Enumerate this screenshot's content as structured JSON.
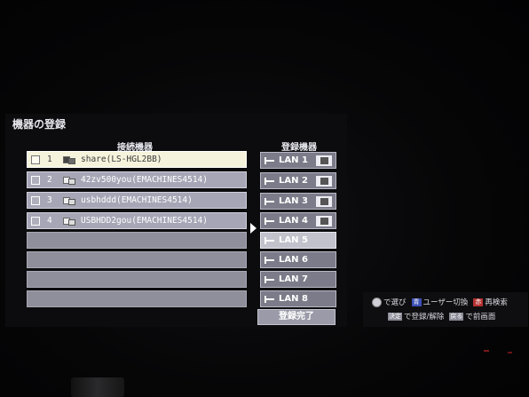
{
  "screen": {
    "title": "機器の登録",
    "connected_header": "接続機器",
    "registered_header": "登録機器"
  },
  "connected_devices": [
    {
      "num": "1",
      "name": "share(LS-HGL2BB)",
      "selected": true
    },
    {
      "num": "2",
      "name": "42zv500you(EMACHINES4514)",
      "selected": false
    },
    {
      "num": "3",
      "name": "usbhddd(EMACHINES4514)",
      "selected": false
    },
    {
      "num": "4",
      "name": "USBHDD2gou(EMACHINES4514)",
      "selected": false
    }
  ],
  "registered": [
    {
      "label": "LAN 1",
      "has_device": true
    },
    {
      "label": "LAN 2",
      "has_device": true
    },
    {
      "label": "LAN 3",
      "has_device": true
    },
    {
      "label": "LAN 4",
      "has_device": true
    },
    {
      "label": "LAN 5",
      "has_device": false
    },
    {
      "label": "LAN 6",
      "has_device": false
    },
    {
      "label": "LAN 7",
      "has_device": false
    },
    {
      "label": "LAN 8",
      "has_device": false
    }
  ],
  "done_button": "登録完了",
  "help": {
    "select": "で選び",
    "user_key": "青",
    "user_switch": "ユーザー切換",
    "research_key": "赤",
    "research": "再検索",
    "enter_key": "決定",
    "register": "で登録/解除",
    "back_key": "戻る",
    "back": "で前画面"
  },
  "colors": {
    "selected_row": "#f6f3dc",
    "row": "#a6a6b6",
    "lan_highlight": "#c2c2cc",
    "blue_key": "#3b4fb4",
    "red_key": "#b53232"
  }
}
